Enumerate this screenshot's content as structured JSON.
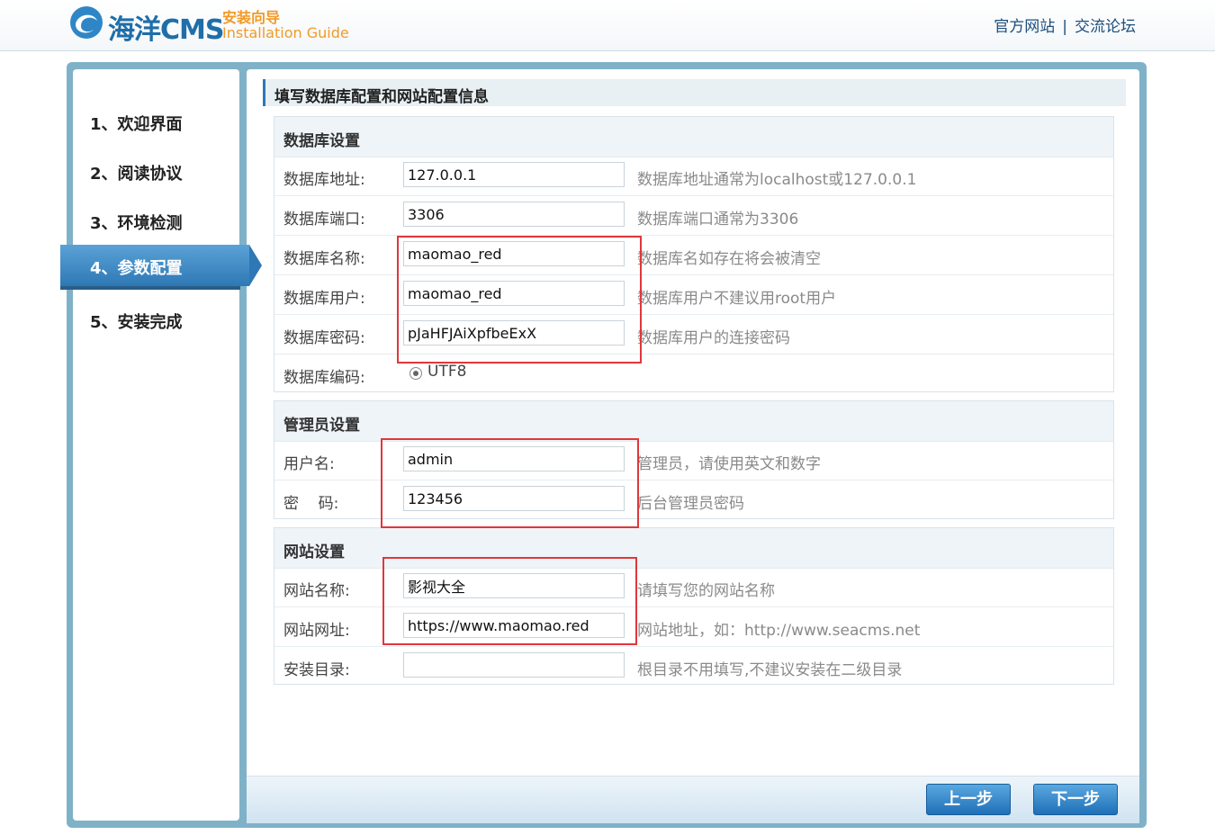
{
  "header": {
    "logo_text": "海洋CMS",
    "guide_cn": "安装向导",
    "guide_en": "Installation Guide",
    "nav": [
      {
        "label": "官方网站"
      },
      {
        "label": "交流论坛"
      }
    ],
    "nav_separator": "|"
  },
  "sidebar": {
    "steps": [
      {
        "label": "1、欢迎界面",
        "active": false
      },
      {
        "label": "2、阅读协议",
        "active": false
      },
      {
        "label": "3、环境检测",
        "active": false
      },
      {
        "label": "4、参数配置",
        "active": true
      },
      {
        "label": "5、安装完成",
        "active": false
      }
    ]
  },
  "main": {
    "title": "填写数据库配置和网站配置信息",
    "db_section": {
      "heading": "数据库设置",
      "host": {
        "label": "数据库地址:",
        "value": "127.0.0.1",
        "hint": "数据库地址通常为localhost或127.0.0.1"
      },
      "port": {
        "label": "数据库端口:",
        "value": "3306",
        "hint": "数据库端口通常为3306"
      },
      "name": {
        "label": "数据库名称:",
        "value": "maomao_red",
        "hint": "数据库名如存在将会被清空"
      },
      "user": {
        "label": "数据库用户:",
        "value": "maomao_red",
        "hint": "数据库用户不建议用root用户"
      },
      "password": {
        "label": "数据库密码:",
        "value": "pJaHFJAiXpfbeExX",
        "hint": "数据库用户的连接密码"
      },
      "charset": {
        "label": "数据库编码:",
        "value": "UTF8"
      }
    },
    "admin_section": {
      "heading": "管理员设置",
      "username": {
        "label": "用户名:",
        "value": "admin",
        "hint": "管理员，请使用英文和数字"
      },
      "password": {
        "label": "密    码:",
        "value": "123456",
        "hint": "后台管理员密码"
      }
    },
    "site_section": {
      "heading": "网站设置",
      "name": {
        "label": "网站名称:",
        "value": "影视大全",
        "hint": "请填写您的网站名称"
      },
      "url": {
        "label": "网站网址:",
        "value": "https://www.maomao.red",
        "hint": "网站地址，如：http://www.seacms.net"
      },
      "dir": {
        "label": "安装目录:",
        "value": "",
        "hint": "根目录不用填写,不建议安装在二级目录"
      }
    }
  },
  "footer": {
    "prev_label": "上一步",
    "next_label": "下一步"
  },
  "colors": {
    "accent": "#2e78b6",
    "frame": "#7fb2c8",
    "annotation_red": "#e0373b",
    "guide_orange": "#f29a26"
  }
}
